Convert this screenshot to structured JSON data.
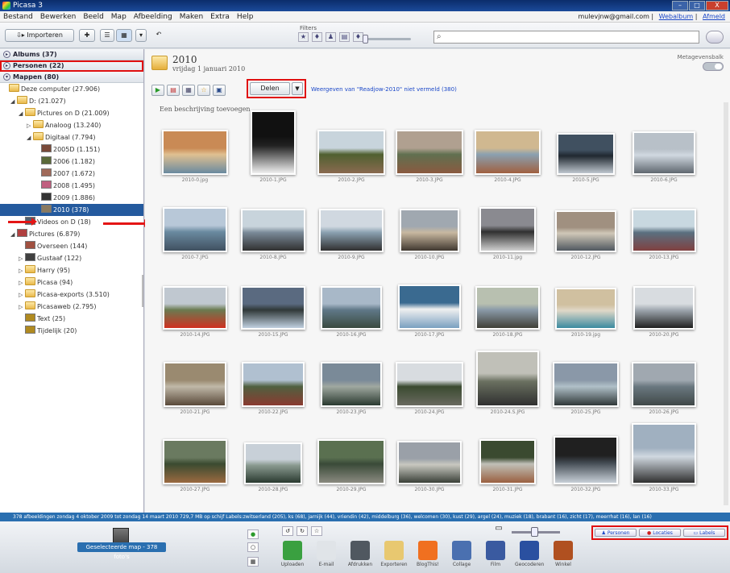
{
  "window": {
    "title": "Picasa 3",
    "controls": [
      "–",
      "□",
      "X"
    ]
  },
  "menu": [
    "Bestand",
    "Bewerken",
    "Beeld",
    "Map",
    "Afbeelding",
    "Maken",
    "Extra",
    "Help"
  ],
  "account": {
    "email": "mulevjnw@gmail.com",
    "links": [
      "Webalbum",
      "Afmeld"
    ]
  },
  "toolbar": {
    "import_label": "Importeren",
    "filters_label": "Filters",
    "filter_icons": [
      "★",
      "♦",
      "♟",
      "▤",
      "♦"
    ]
  },
  "left": {
    "sections": [
      {
        "label": "Albums (37)",
        "toggle": "▸"
      },
      {
        "label": "Personen (22)",
        "toggle": "▸"
      },
      {
        "label": "Mappen (80)",
        "toggle": "▾"
      }
    ],
    "tree": [
      {
        "label": "Deze computer (27.906)",
        "indent": 0,
        "icon": "folder",
        "tw": ""
      },
      {
        "label": "D: (21.027)",
        "indent": 1,
        "icon": "folder",
        "tw": "◢"
      },
      {
        "label": "Pictures on D (21.009)",
        "indent": 2,
        "icon": "folder",
        "tw": "◢"
      },
      {
        "label": "Analoog (13.240)",
        "indent": 3,
        "icon": "folder",
        "tw": "▷"
      },
      {
        "label": "Digitaal (7.794)",
        "indent": 3,
        "icon": "folder",
        "tw": "◢"
      },
      {
        "label": "2005D (1.151)",
        "indent": 4,
        "icon": "thumb",
        "color": "#7a4a3a",
        "tw": ""
      },
      {
        "label": "2006 (1.182)",
        "indent": 4,
        "icon": "thumb",
        "color": "#5a6a3a",
        "tw": ""
      },
      {
        "label": "2007 (1.672)",
        "indent": 4,
        "icon": "thumb",
        "color": "#a06a5a",
        "tw": ""
      },
      {
        "label": "2008 (1.495)",
        "indent": 4,
        "icon": "thumb",
        "color": "#c06080",
        "tw": ""
      },
      {
        "label": "2009 (1.886)",
        "indent": 4,
        "icon": "thumb",
        "color": "#333333",
        "tw": ""
      },
      {
        "label": "2010 (378)",
        "indent": 4,
        "icon": "thumb",
        "color": "#8a7a60",
        "tw": "",
        "selected": true
      },
      {
        "label": "Videos on D (18)",
        "indent": 2,
        "icon": "thumb",
        "color": "#506070",
        "tw": ""
      },
      {
        "label": "Pictures (6.879)",
        "indent": 1,
        "icon": "thumb",
        "color": "#b04040",
        "tw": "◢"
      },
      {
        "label": "Overseen (144)",
        "indent": 2,
        "icon": "thumb",
        "color": "#a05040",
        "tw": ""
      },
      {
        "label": "Gustaaf (122)",
        "indent": 2,
        "icon": "thumb",
        "color": "#404040",
        "tw": "▷"
      },
      {
        "label": "Harry (95)",
        "indent": 2,
        "icon": "folder",
        "tw": "▷"
      },
      {
        "label": "Picasa (94)",
        "indent": 2,
        "icon": "folder",
        "tw": "▷"
      },
      {
        "label": "Picasa-exports (3.510)",
        "indent": 2,
        "icon": "folder",
        "tw": "▷"
      },
      {
        "label": "Picasaweb (2.795)",
        "indent": 2,
        "icon": "folder",
        "tw": "▷"
      },
      {
        "label": "Text (25)",
        "indent": 2,
        "icon": "thumb",
        "color": "#b08a20",
        "tw": ""
      },
      {
        "label": "Tijdelijk (20)",
        "indent": 2,
        "icon": "thumb",
        "color": "#b08a20",
        "tw": ""
      }
    ]
  },
  "main": {
    "album_title": "2010",
    "album_date": "vrijdag 1 januari 2010",
    "meta_label": "Metagevensbalk",
    "share_label": "Delen",
    "share_dropdown": "▼",
    "share_link": "Weergeven van \"Readjow-2010\" niet vermeld (380)",
    "description": "Een beschrijving toevoegen",
    "photos": [
      {
        "caption": "2010-0.jpg",
        "colors": [
          "#c98a55",
          "#6a8aa0",
          "#e0c090"
        ]
      },
      {
        "caption": "2010-1.JPG",
        "colors": [
          "#111111",
          "#f0f0f0",
          "#222222"
        ]
      },
      {
        "caption": "2010-2.JPG",
        "colors": [
          "#c8d4dc",
          "#8a6a50",
          "#506030"
        ]
      },
      {
        "caption": "2010-3.JPG",
        "colors": [
          "#b0a090",
          "#8a5a40",
          "#607050"
        ]
      },
      {
        "caption": "2010-4.JPG",
        "colors": [
          "#d0b890",
          "#a06040",
          "#8aa0b0"
        ]
      },
      {
        "caption": "2010-5.JPG",
        "colors": [
          "#405060",
          "#c0c8d0",
          "#202830"
        ]
      },
      {
        "caption": "2010-6.JPG",
        "colors": [
          "#b8c0c8",
          "#606870",
          "#d0d8e0"
        ]
      },
      {
        "caption": "2010-7.JPG",
        "colors": [
          "#b8c8d8",
          "#405060",
          "#6a8aa0"
        ]
      },
      {
        "caption": "2010-8.JPG",
        "colors": [
          "#c8d4dc",
          "#303030",
          "#7a8a98"
        ]
      },
      {
        "caption": "2010-9.JPG",
        "colors": [
          "#d0d8e0",
          "#303030",
          "#8aa0b0"
        ]
      },
      {
        "caption": "2010-10.JPG",
        "colors": [
          "#a0a8b0",
          "#403830",
          "#c8b8a0"
        ]
      },
      {
        "caption": "2010-11.jpg",
        "colors": [
          "#8a8a90",
          "#d0d0d0",
          "#303030"
        ]
      },
      {
        "caption": "2010-12.JPG",
        "colors": [
          "#a09080",
          "#505860",
          "#d0c8b8"
        ]
      },
      {
        "caption": "2010-13.JPG",
        "colors": [
          "#c8d8e0",
          "#804040",
          "#5a7080"
        ]
      },
      {
        "caption": "2010-14.JPG",
        "colors": [
          "#c0c8d0",
          "#d03020",
          "#6a7a50"
        ]
      },
      {
        "caption": "2010-15.JPG",
        "colors": [
          "#5a6a80",
          "#c0d0e0",
          "#303838"
        ]
      },
      {
        "caption": "2010-16.JPG",
        "colors": [
          "#a8b8c8",
          "#3a4a40",
          "#607888"
        ]
      },
      {
        "caption": "2010-17.JPG",
        "colors": [
          "#3a6a90",
          "#7aa0c0",
          "#f0f0f0"
        ]
      },
      {
        "caption": "2010-18.JPG",
        "colors": [
          "#b8c0b0",
          "#404038",
          "#8a9aa8"
        ]
      },
      {
        "caption": "2010-19.jpg",
        "colors": [
          "#d0c0a0",
          "#3a8aa0",
          "#e0d8c8"
        ]
      },
      {
        "caption": "2010-20.JPG",
        "colors": [
          "#d8dce0",
          "#202020",
          "#a0a8b0"
        ]
      },
      {
        "caption": "2010-21.JPG",
        "colors": [
          "#9a8a70",
          "#5a4a3a",
          "#c0b8a8"
        ]
      },
      {
        "caption": "2010-22.JPG",
        "colors": [
          "#b0c0d0",
          "#8a3a30",
          "#506040"
        ]
      },
      {
        "caption": "2010-23.JPG",
        "colors": [
          "#7a8a98",
          "#2a3a30",
          "#a0a8a0"
        ]
      },
      {
        "caption": "2010-24.JPG",
        "colors": [
          "#d8dce0",
          "#6a6a60",
          "#3a4a30"
        ]
      },
      {
        "caption": "2010-24.S.JPG",
        "colors": [
          "#c0c0b8",
          "#303030",
          "#6a7060"
        ]
      },
      {
        "caption": "2010-25.JPG",
        "colors": [
          "#8a98a8",
          "#303838",
          "#b0c0c8"
        ]
      },
      {
        "caption": "2010-26.JPG",
        "colors": [
          "#a0a8b0",
          "#404848",
          "#6a7880"
        ]
      },
      {
        "caption": "2010-27.JPG",
        "colors": [
          "#6a7a60",
          "#9a6a40",
          "#3a4a30"
        ]
      },
      {
        "caption": "2010-28.JPG",
        "colors": [
          "#c8d0d8",
          "#2a3a30",
          "#8a9a90"
        ]
      },
      {
        "caption": "2010-29.JPG",
        "colors": [
          "#5a7050",
          "#8a8a80",
          "#3a4a38"
        ]
      },
      {
        "caption": "2010-30.JPG",
        "colors": [
          "#9aa0a8",
          "#3a4038",
          "#c8c8c0"
        ]
      },
      {
        "caption": "2010-31.JPG",
        "colors": [
          "#3a4a30",
          "#9a6040",
          "#c0c0b8"
        ]
      },
      {
        "caption": "2010-32.JPG",
        "colors": [
          "#202020",
          "#c8d0d8",
          "#404850"
        ]
      },
      {
        "caption": "2010-33.JPG",
        "colors": [
          "#a0b0c0",
          "#303030",
          "#d0d8e0"
        ]
      }
    ]
  },
  "status": "378 afbeeldingen   zondag 4 oktober 2009 tot zondag 14 maart 2010   729,7 MB op schijf   Labels:zwitserland (205), ks (68), jarnijk (44), vriendin (42), middelburg (36), welcomen (30), kust (29), argel (24), muziek (18), brabant (16), zicht (17), meerrhat (16), lan (16)",
  "bottom": {
    "tray_label": "Geselecteerde map - 378 foto's",
    "tools": [
      {
        "label": "Uploaden",
        "color": "#3aa040"
      },
      {
        "label": "E-mail",
        "color": "#e0e4e8"
      },
      {
        "label": "Afdrukken",
        "color": "#505860"
      },
      {
        "label": "Exporteren",
        "color": "#e8c870"
      },
      {
        "label": "BlogThis!",
        "color": "#f07020"
      },
      {
        "label": "Collage",
        "color": "#4a70b0"
      },
      {
        "label": "Film",
        "color": "#3a5aa0"
      },
      {
        "label": "Geocoderen",
        "color": "#2a50a0"
      },
      {
        "label": "Winkel",
        "color": "#b05020"
      }
    ],
    "right_buttons": [
      "Personen",
      "Locaties",
      "Labels"
    ]
  }
}
